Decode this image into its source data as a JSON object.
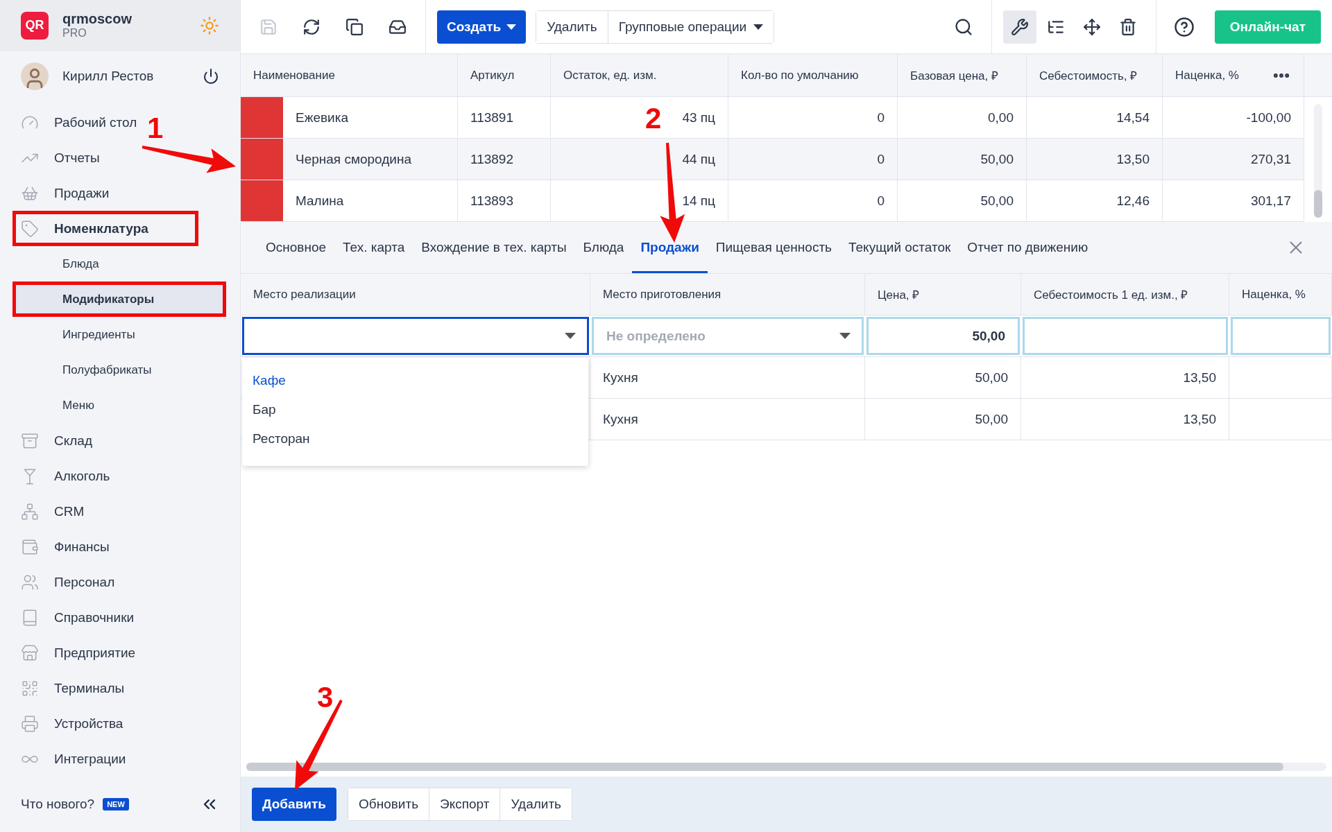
{
  "brand": {
    "logo": "QR",
    "name": "qrmoscow",
    "plan": "PRO"
  },
  "user": {
    "name": "Кирилл Рестов"
  },
  "nav": [
    {
      "label": "Рабочий стол",
      "selected": false,
      "framed": false
    },
    {
      "label": "Отчеты",
      "selected": false,
      "framed": false
    },
    {
      "label": "Продажи",
      "selected": false,
      "framed": false
    },
    {
      "label": "Номенклатура",
      "selected": false,
      "framed": true,
      "expanded": true,
      "children": [
        {
          "label": "Блюда",
          "selected": false,
          "framed": false
        },
        {
          "label": "Модификаторы",
          "selected": true,
          "framed": true
        },
        {
          "label": "Ингредиенты",
          "selected": false,
          "framed": false
        },
        {
          "label": "Полуфабрикаты",
          "selected": false,
          "framed": false
        },
        {
          "label": "Меню",
          "selected": false,
          "framed": false
        }
      ]
    },
    {
      "label": "Склад",
      "selected": false,
      "framed": false
    },
    {
      "label": "Алкоголь",
      "selected": false,
      "framed": false
    },
    {
      "label": "CRM",
      "selected": false,
      "framed": false
    },
    {
      "label": "Финансы",
      "selected": false,
      "framed": false
    },
    {
      "label": "Персонал",
      "selected": false,
      "framed": false
    },
    {
      "label": "Справочники",
      "selected": false,
      "framed": false
    },
    {
      "label": "Предприятие",
      "selected": false,
      "framed": false
    },
    {
      "label": "Терминалы",
      "selected": false,
      "framed": false
    },
    {
      "label": "Устройства",
      "selected": false,
      "framed": false
    },
    {
      "label": "Интеграции",
      "selected": false,
      "framed": false
    }
  ],
  "whats_new": {
    "label": "Что нового?",
    "badge": "NEW"
  },
  "toolbar": {
    "save_disabled": true,
    "create": "Создать",
    "delete": "Удалить",
    "group_ops": "Групповые операции",
    "tools_active": true,
    "chat": "Онлайн-чат"
  },
  "table": {
    "columns": [
      "Наименование",
      "Артикул",
      "Остаток, ед. изм.",
      "Кол-во по умолчанию",
      "Базовая цена, ₽",
      "Себестоимость, ₽",
      "Наценка, %"
    ],
    "rows": [
      {
        "color": "#e03535",
        "cells": [
          "Ежевика",
          "113891",
          "43 пц",
          "0",
          "0,00",
          "14,54",
          "-100,00"
        ]
      },
      {
        "color": "#e03535",
        "cells": [
          "Черная смородина",
          "113892",
          "44 пц",
          "0",
          "50,00",
          "13,50",
          "270,31"
        ]
      },
      {
        "color": "#e03535",
        "cells": [
          "Малина",
          "113893",
          "14 пц",
          "0",
          "50,00",
          "12,46",
          "301,17"
        ]
      }
    ]
  },
  "tabs": [
    {
      "label": "Основное",
      "selected": false
    },
    {
      "label": "Тех. карта",
      "selected": false
    },
    {
      "label": "Вхождение в тех. карты",
      "selected": false
    },
    {
      "label": "Блюда",
      "selected": false
    },
    {
      "label": "Продажи",
      "selected": true
    },
    {
      "label": "Пищевая ценность",
      "selected": false
    },
    {
      "label": "Текущий остаток",
      "selected": false
    },
    {
      "label": "Отчет по движению",
      "selected": false
    }
  ],
  "sales": {
    "columns": [
      "Место реализации",
      "Место приготовления",
      "Цена, ₽",
      "Себестоимость 1 ед. изм., ₽",
      "Наценка, %"
    ],
    "edit_row": {
      "prep_placeholder": "Не определено",
      "price": "50,00"
    },
    "dropdown": [
      {
        "label": "Кафе",
        "selected": true
      },
      {
        "label": "Бар",
        "selected": false
      },
      {
        "label": "Ресторан",
        "selected": false
      }
    ],
    "rows": [
      {
        "cells": [
          "",
          "Кухня",
          "50,00",
          "13,50"
        ]
      },
      {
        "cells": [
          "",
          "Кухня",
          "50,00",
          "13,50"
        ]
      }
    ]
  },
  "footer": {
    "primary": "Добавить",
    "buttons": [
      "Обновить",
      "Экспорт",
      "Удалить"
    ]
  },
  "annotations": [
    "1",
    "2",
    "3"
  ]
}
